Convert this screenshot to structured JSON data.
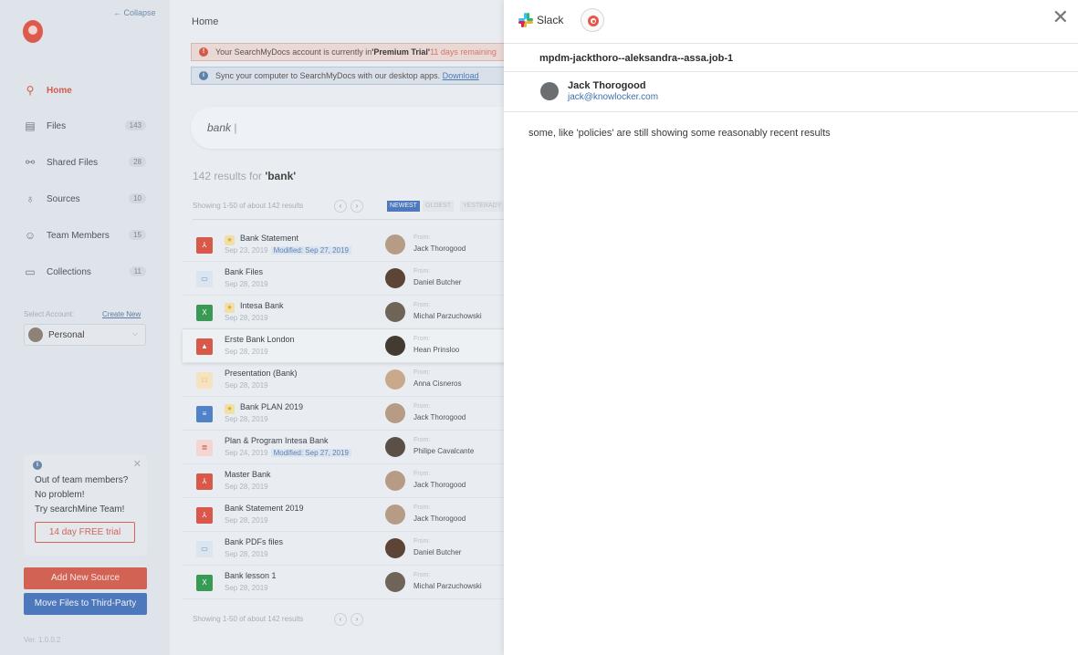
{
  "sidebar": {
    "collapse": "← Collapse",
    "nav": [
      {
        "label": "Home",
        "count": "",
        "icon": "search-icon"
      },
      {
        "label": "Files",
        "count": "143",
        "icon": "file-icon"
      },
      {
        "label": "Shared Files",
        "count": "28",
        "icon": "share-icon"
      },
      {
        "label": "Sources",
        "count": "10",
        "icon": "lightbulb-icon"
      },
      {
        "label": "Team Members",
        "count": "15",
        "icon": "team-icon"
      },
      {
        "label": "Collections",
        "count": "11",
        "icon": "folder-icon"
      }
    ],
    "account_label": "Select Account:",
    "create_new": "Create New",
    "account": "Personal",
    "promo": {
      "line1": "Out of team members?",
      "line2": "No problem!",
      "line3": "Try searchMine Team!",
      "button": "14 day FREE trial"
    },
    "add_source": "Add New Source",
    "move_files": "Move Files to Third-Party",
    "version": "Ver. 1.0.0.2"
  },
  "main": {
    "title": "Home",
    "banner_trial_pre": "Your SearchMyDocs account is currently in ",
    "banner_trial_bold": "'Premium Trial'",
    "banner_trial_days": " 11 days remaining",
    "banner_sync": "Sync your computer to SearchMyDocs with our desktop apps.",
    "banner_download": "Download",
    "search_value": "bank",
    "results_count": "142 results for ",
    "results_query": "'bank'",
    "showing": "Showing 1-50 of about 142 results",
    "filters": [
      "NEWEST",
      "OLDEST",
      "YESTERADY"
    ],
    "from_label": "From:",
    "modified_prefix": "Modified: ",
    "files": [
      {
        "name": "Bank Statement",
        "date": "Sep 23, 2019",
        "modified": "Sep 27, 2019",
        "from": "Jack Thorogood",
        "type": "pdf",
        "starred": true
      },
      {
        "name": "Bank Files",
        "date": "Sep 28, 2019",
        "modified": "",
        "from": "Daniel Butcher",
        "type": "folder",
        "starred": false
      },
      {
        "name": "Intesa Bank",
        "date": "Sep 28, 2019",
        "modified": "",
        "from": "Michal Parzuchowski",
        "type": "xls",
        "starred": true
      },
      {
        "name": "Erste Bank London",
        "date": "Sep 28, 2019",
        "modified": "",
        "from": "Hean Prinsloo",
        "type": "img",
        "starred": false
      },
      {
        "name": "Presentation (Bank)",
        "date": "Sep 28, 2019",
        "modified": "",
        "from": "Anna Cisneros",
        "type": "ppt",
        "starred": false
      },
      {
        "name": "Bank PLAN 2019",
        "date": "Sep 28, 2019",
        "modified": "",
        "from": "Jack Thorogood",
        "type": "doc",
        "starred": true
      },
      {
        "name": "Plan & Program Intesa Bank",
        "date": "Sep 24, 2019",
        "modified": "Sep 27, 2019",
        "from": "Philipe Cavalcante",
        "type": "txt",
        "starred": false
      },
      {
        "name": "Master Bank",
        "date": "Sep 28, 2019",
        "modified": "",
        "from": "Jack Thorogood",
        "type": "pdf",
        "starred": false
      },
      {
        "name": "Bank Statement 2019",
        "date": "Sep 28, 2019",
        "modified": "",
        "from": "Jack Thorogood",
        "type": "pdf",
        "starred": false
      },
      {
        "name": "Bank PDFs files",
        "date": "Sep 28, 2019",
        "modified": "",
        "from": "Daniel Butcher",
        "type": "folder",
        "starred": false
      },
      {
        "name": "Bank lesson 1",
        "date": "Sep 28, 2019",
        "modified": "",
        "from": "Michal Parzuchowski",
        "type": "xls",
        "starred": false
      }
    ]
  },
  "panel": {
    "source": "Slack",
    "channel": "mpdm-jackthoro--aleksandra--assa.job-1",
    "user_name": "Jack Thorogood",
    "user_email": "jack@knowlocker.com",
    "message": "some, like 'policies' are still showing some reasonably recent results"
  },
  "colors": {
    "accent_red": "#d25b4e",
    "accent_blue": "#4f79bd",
    "link_blue": "#3c6fb0"
  }
}
